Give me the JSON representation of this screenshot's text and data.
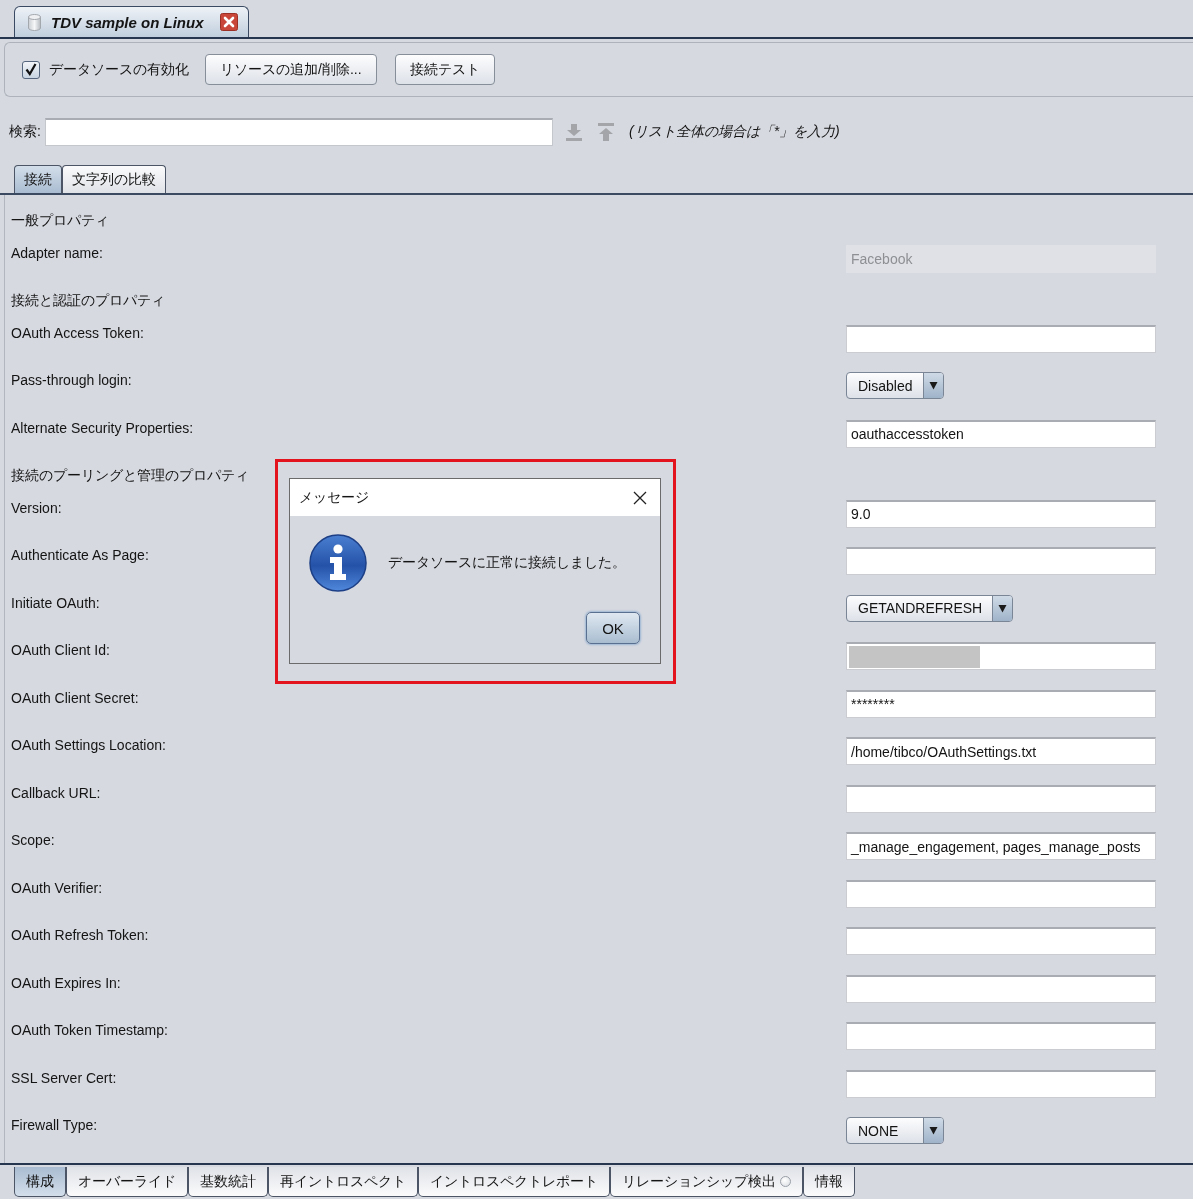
{
  "document_tab": {
    "title": "TDV sample on Linux"
  },
  "toolbar": {
    "enable_checkbox": {
      "label": "データソースの有効化",
      "checked": true
    },
    "buttons": [
      "リソースの追加/削除...",
      "接続テスト"
    ]
  },
  "search": {
    "label": "検索:",
    "hint": "(リスト全体の場合は「*」を入力)"
  },
  "tabs": [
    {
      "label": "接続",
      "selected": true
    },
    {
      "label": "文字列の比較",
      "selected": false
    }
  ],
  "properties": [
    {
      "kind": "section",
      "label": "一般プロパティ"
    },
    {
      "kind": "readonly",
      "label": "Adapter name:",
      "value": "Facebook"
    },
    {
      "kind": "section",
      "label": "接続と認証のプロパティ"
    },
    {
      "kind": "text",
      "label": "OAuth Access Token:"
    },
    {
      "kind": "combo",
      "label": "Pass-through login:",
      "value": "Disabled"
    },
    {
      "kind": "text",
      "label": "Alternate Security Properties:",
      "value": "oauthaccesstoken"
    },
    {
      "kind": "section",
      "label": "接続のプーリングと管理のプロパティ"
    },
    {
      "kind": "text",
      "label": "Version:",
      "value": "9.0"
    },
    {
      "kind": "text",
      "label": "Authenticate As Page:"
    },
    {
      "kind": "combo",
      "label": "Initiate OAuth:",
      "value": "GETANDREFRESH"
    },
    {
      "kind": "redacted",
      "label": "OAuth Client Id:"
    },
    {
      "kind": "text",
      "label": "OAuth Client Secret:",
      "value": "********"
    },
    {
      "kind": "text",
      "label": "OAuth Settings Location:",
      "value": "/home/tibco/OAuthSettings.txt"
    },
    {
      "kind": "text",
      "label": "Callback URL:"
    },
    {
      "kind": "text",
      "label": "Scope:",
      "value": "_manage_engagement, pages_manage_posts"
    },
    {
      "kind": "text",
      "label": "OAuth Verifier:"
    },
    {
      "kind": "text",
      "label": "OAuth Refresh Token:"
    },
    {
      "kind": "text",
      "label": "OAuth Expires In:"
    },
    {
      "kind": "text",
      "label": "OAuth Token Timestamp:"
    },
    {
      "kind": "text",
      "label": "SSL Server Cert:"
    },
    {
      "kind": "combo",
      "label": "Firewall Type:",
      "value": "NONE"
    }
  ],
  "dialog": {
    "title": "メッセージ",
    "message": "データソースに正常に接続しました。",
    "button": "OK"
  },
  "bottom_tabs": [
    {
      "label": "構成",
      "selected": true,
      "indicator": false
    },
    {
      "label": "オーバーライド",
      "selected": false,
      "indicator": false
    },
    {
      "label": "基数統計",
      "selected": false,
      "indicator": false
    },
    {
      "label": "再イントロスペクト",
      "selected": false,
      "indicator": false
    },
    {
      "label": "イントロスペクトレポート",
      "selected": false,
      "indicator": false
    },
    {
      "label": "リレーションシップ検出",
      "selected": false,
      "indicator": true
    },
    {
      "label": "情報",
      "selected": false,
      "indicator": false
    }
  ]
}
